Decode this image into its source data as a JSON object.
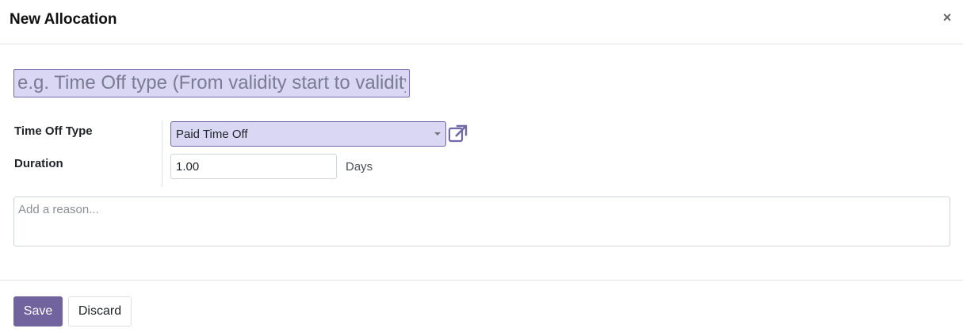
{
  "dialog": {
    "title": "New Allocation",
    "close_symbol": "×"
  },
  "form": {
    "name_placeholder": "e.g. Time Off type (From validity start to validity end / no limit)",
    "name_value": "",
    "time_off_type": {
      "label": "Time Off Type",
      "value": "Paid Time Off",
      "external_link_icon": "external-link-icon"
    },
    "duration": {
      "label": "Duration",
      "value": "1.00",
      "unit": "Days"
    },
    "reason_placeholder": "Add a reason..."
  },
  "footer": {
    "save_label": "Save",
    "discard_label": "Discard"
  },
  "colors": {
    "primary": "#71639e",
    "field_highlight": "#d9d7f4",
    "field_border": "#6f6aa6"
  }
}
